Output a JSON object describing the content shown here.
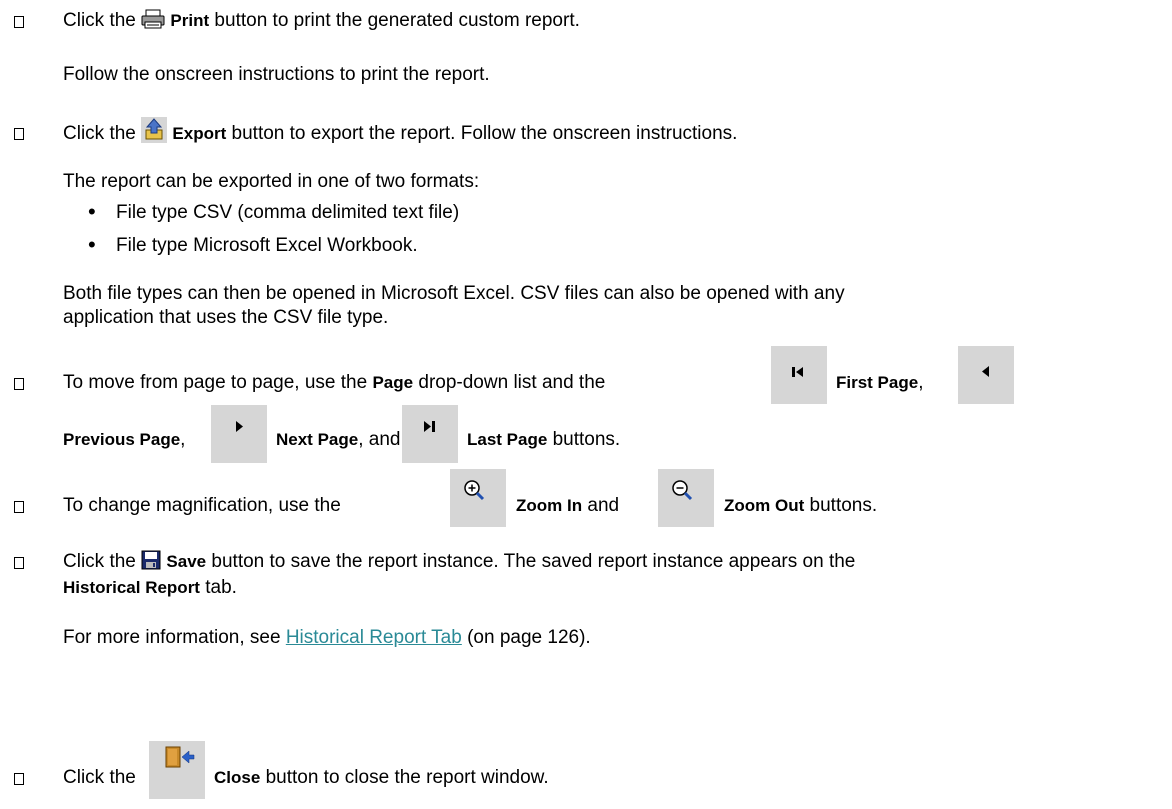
{
  "items": {
    "print": {
      "pre": "Click the ",
      "label": "Print",
      "post": " button to print the generated custom report.",
      "note": "Follow the onscreen instructions to print the report."
    },
    "export": {
      "pre": "Click the ",
      "label": "Export",
      "post": " button to export the report. Follow the onscreen instructions.",
      "intro": "The report can be exported in one of two formats:",
      "formats": [
        "File type CSV (comma delimited text file)",
        "File type Microsoft Excel Workbook."
      ],
      "para_line1": "Both file types can then be opened in Microsoft Excel. CSV files can also be opened with any",
      "para_line2": "application that uses the CSV file type."
    },
    "paging": {
      "pre": "To move from page to page, use the ",
      "page_label": "Page",
      "mid": " drop-down list and the ",
      "first_label": "First Page",
      "comma1": ",",
      "prev_label": "Previous Page",
      "comma2": ",",
      "next_label": "Next Page",
      "and": ", and ",
      "last_label": "Last Page",
      "post": " buttons."
    },
    "zoom": {
      "pre": "To change magnification, use the ",
      "in_label": "Zoom In",
      "and": " and ",
      "out_label": "Zoom Out",
      "post": " buttons."
    },
    "save": {
      "pre": "Click the ",
      "label": "Save",
      "post": " button to save the report instance. The saved report instance appears on the",
      "tab_label": "Historical Report",
      "tab_post": " tab.",
      "more_pre": "For more information, see ",
      "link": "Historical Report Tab",
      "more_post": " (on page 126)."
    },
    "close": {
      "pre": "Click the ",
      "label": "Close",
      "post": " button to close the report window."
    }
  },
  "icons": {
    "print": "printer-icon",
    "export": "export-icon",
    "first": "first-page-icon",
    "prev": "previous-page-icon",
    "next": "next-page-icon",
    "last": "last-page-icon",
    "zoom_in": "zoom-in-icon",
    "zoom_out": "zoom-out-icon",
    "save": "save-icon",
    "close": "close-door-icon"
  },
  "colors": {
    "link": "#2a8a96",
    "button_bg": "#d6d6d6"
  }
}
